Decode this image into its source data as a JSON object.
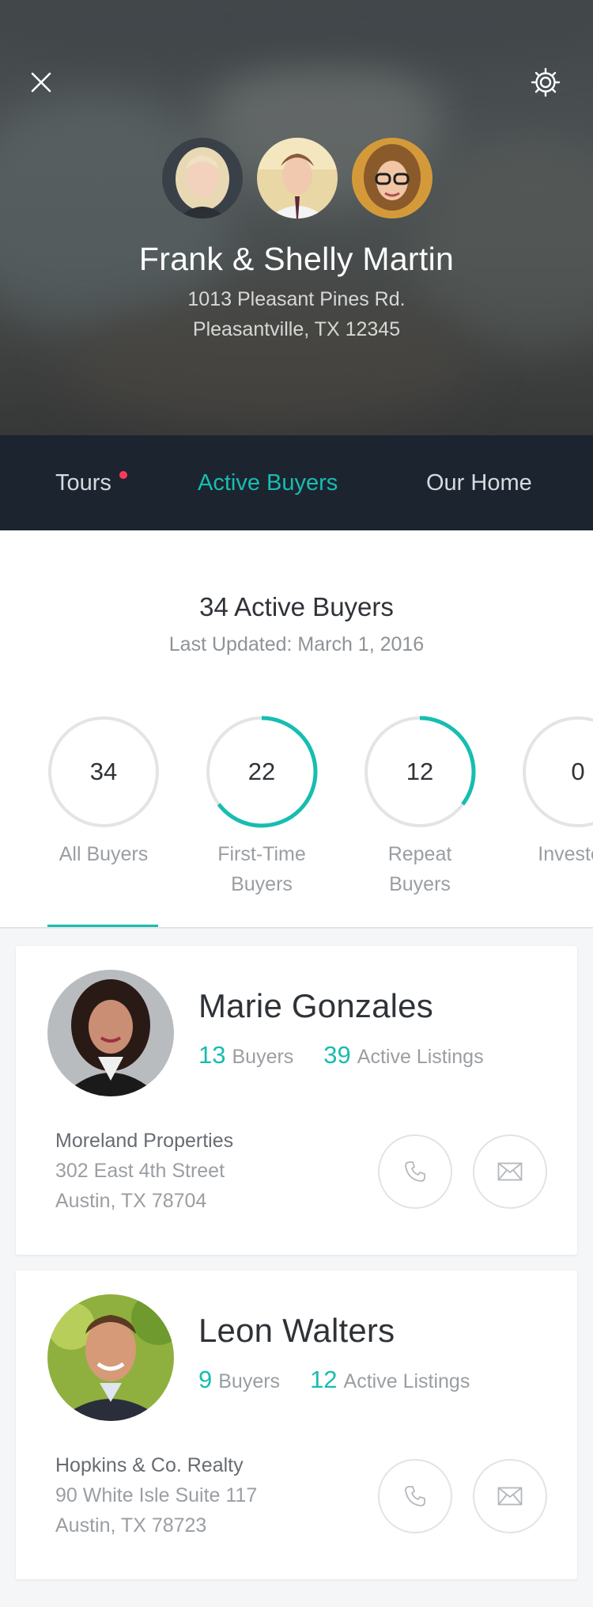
{
  "header": {
    "close_icon": "close-icon",
    "settings_icon": "gear-icon",
    "family_name": "Frank & Shelly Martin",
    "address_line1": "1013 Pleasant Pines Rd.",
    "address_line2": "Pleasantville, TX 12345"
  },
  "tabs": [
    {
      "label": "Tours",
      "has_notification": true
    },
    {
      "label": "Active Buyers",
      "active": true
    },
    {
      "label": "Our Home"
    }
  ],
  "summary": {
    "title": "34 Active Buyers",
    "updated": "Last Updated: March 1, 2016",
    "stats": [
      {
        "value": "34",
        "label_line1": "All Buyers",
        "label_line2": "",
        "fraction": 0
      },
      {
        "value": "22",
        "label_line1": "First-Time",
        "label_line2": "Buyers",
        "fraction": 0.647
      },
      {
        "value": "12",
        "label_line1": "Repeat",
        "label_line2": "Buyers",
        "fraction": 0.353
      },
      {
        "value": "0",
        "label_line1": "Investors",
        "label_line2": "",
        "fraction": 0
      }
    ]
  },
  "agents": [
    {
      "name": "Marie Gonzales",
      "buyers_count": "13",
      "buyers_label": "Buyers",
      "listings_count": "39",
      "listings_label": "Active Listings",
      "company": "Moreland Properties",
      "street": "302 East 4th Street",
      "city": "Austin, TX 78704"
    },
    {
      "name": "Leon Walters",
      "buyers_count": "9",
      "buyers_label": "Buyers",
      "listings_count": "12",
      "listings_label": "Active Listings",
      "company": "Hopkins & Co. Realty",
      "street": "90 White Isle Suite 117",
      "city": "Austin, TX 78723"
    }
  ],
  "colors": {
    "accent": "#17bdb0",
    "nav_bg": "#1c2430",
    "notification": "#ff3a5a"
  }
}
